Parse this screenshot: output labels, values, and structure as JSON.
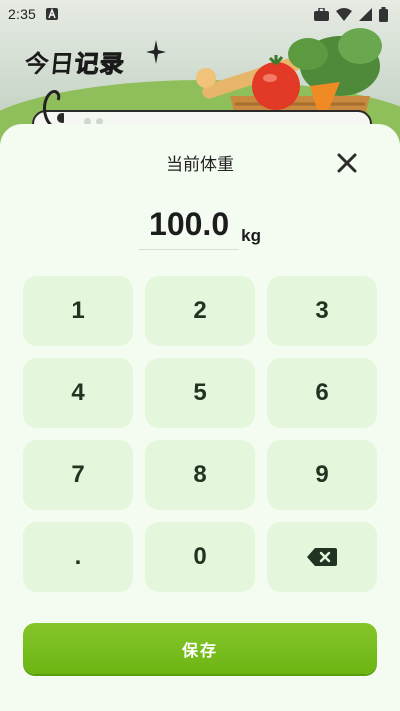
{
  "status_bar": {
    "time": "2:35",
    "icons": [
      "notification-a-icon",
      "briefcase-icon",
      "wifi-icon",
      "signal-icon",
      "battery-icon"
    ]
  },
  "banner": {
    "title_part1": "今日",
    "title_part2": "记录",
    "illustration": "vegetable-basket-icon"
  },
  "dialog": {
    "title": "当前体重",
    "weight_value": "100.0",
    "unit": "kg",
    "keys": [
      "1",
      "2",
      "3",
      "4",
      "5",
      "6",
      "7",
      "8",
      "9",
      ".",
      "0"
    ],
    "backspace_icon": "backspace-icon",
    "close_icon": "close-icon",
    "save_label": "保存"
  },
  "colors": {
    "accent": "#7bc11a",
    "sheet_bg": "#f4fbf1",
    "key_bg": "#e4f6dc",
    "save_button": "#72b91a"
  }
}
